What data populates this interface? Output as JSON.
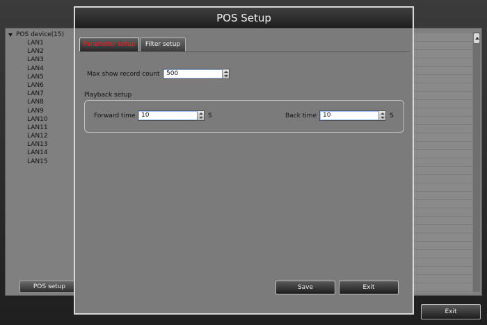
{
  "background": {
    "tree": {
      "root_label": "POS device(15)",
      "items": [
        "LAN1",
        "LAN2",
        "LAN3",
        "LAN4",
        "LAN5",
        "LAN6",
        "LAN7",
        "LAN8",
        "LAN9",
        "LAN10",
        "LAN11",
        "LAN12",
        "LAN13",
        "LAN14",
        "LAN15"
      ]
    },
    "pos_setup_button": "POS setup",
    "exit_button": "Exit"
  },
  "dialog": {
    "title": "POS Setup",
    "tabs": [
      {
        "label": "Parameter setup",
        "active": true
      },
      {
        "label": "Filter setup",
        "active": false
      }
    ],
    "max_show_record_count": {
      "label": "Max show record count",
      "value": "500"
    },
    "playback_group_label": "Playback setup",
    "forward_time": {
      "label": "Forward time",
      "value": "10",
      "unit": "S"
    },
    "back_time": {
      "label": "Back time",
      "value": "10",
      "unit": "S"
    },
    "save_button": "Save",
    "exit_button": "Exit"
  },
  "colors": {
    "active_tab_text": "#ff2020",
    "dialog_background": "#7b7b7b",
    "title_bar": "#2a2a2a"
  }
}
